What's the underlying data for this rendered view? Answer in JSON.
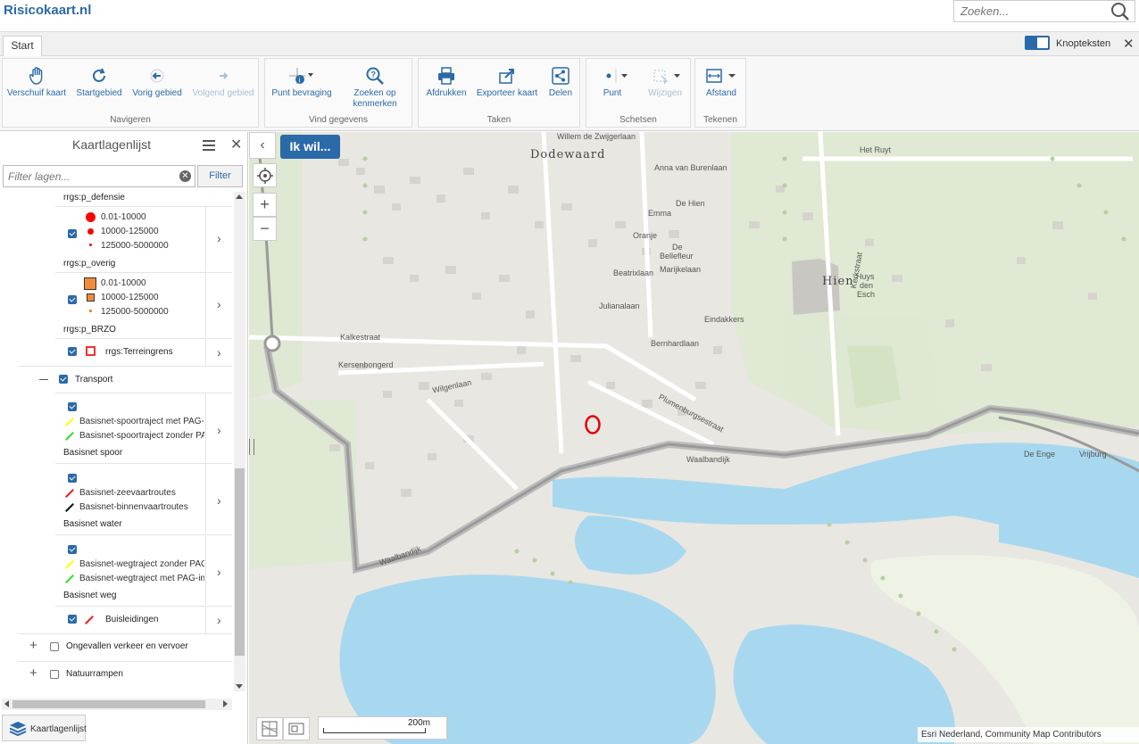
{
  "app": {
    "logo": "Risicokaart.nl"
  },
  "search": {
    "placeholder": "Zoeken..."
  },
  "tabs": {
    "start": "Start"
  },
  "toggle": {
    "label": "Knopteksten"
  },
  "ribbon": {
    "navigeren": {
      "label": "Navigeren",
      "verschuif": "Verschuif kaart",
      "startgebied": "Startgebied",
      "vorig": "Vorig gebied",
      "volgend": "Volgend gebied"
    },
    "vind": {
      "label": "Vind gegevens",
      "punt": "Punt bevraging",
      "zoeken1": "Zoeken op",
      "zoeken2": "kenmerken"
    },
    "taken": {
      "label": "Taken",
      "afdrukken": "Afdrukken",
      "exporteer": "Exporteer kaart",
      "delen": "Delen"
    },
    "schetsen": {
      "label": "Schetsen",
      "punt": "Punt",
      "wijzigen": "Wijzigen"
    },
    "tekenen": {
      "label": "Tekenen",
      "afstand": "Afstand"
    }
  },
  "panel": {
    "title": "Kaartlagenlijst",
    "filter_placeholder": "Filter lagen...",
    "filter_button": "Filter",
    "bottom_tab": "Kaartlagenlijst"
  },
  "layers": {
    "defensie": {
      "name": "rrgs:p_defensie",
      "legend": [
        "0.01-10000",
        "10000-125000",
        "125000-5000000"
      ]
    },
    "overig": {
      "name": "rrgs:p_overig",
      "legend": [
        "0.01-10000",
        "10000-125000",
        "125000-5000000"
      ]
    },
    "brzo": {
      "name": "rrgs:p_BRZO"
    },
    "terreingrens": {
      "name": "rrgs:Terreingrens"
    },
    "transport": {
      "name": "Transport"
    },
    "spoor": {
      "name": "Basisnet spoor",
      "legend": [
        "Basisnet-spoortraject met PAG-in",
        "Basisnet-spoortraject zonder PAG"
      ]
    },
    "water": {
      "name": "Basisnet water",
      "legend": [
        "Basisnet-zeevaartroutes",
        "Basisnet-binnenvaartroutes"
      ]
    },
    "weg": {
      "name": "Basisnet weg",
      "legend": [
        "Basisnet-wegtraject zonder PAG",
        "Basisnet-wegtraject met PAG-in"
      ]
    },
    "buisleidingen": {
      "name": "Buisleidingen"
    },
    "ongevallen": {
      "name": "Ongevallen verkeer en vervoer"
    },
    "natuurrampen": {
      "name": "Natuurrampen"
    }
  },
  "map": {
    "ikwil": "Ik wil...",
    "scale": "200m",
    "attribution": "Esri Nederland, Community Map Contributors",
    "labels": {
      "dodewaard": "Dodewaard",
      "hien": "Hien",
      "het_ruyt": "Het Ruyt",
      "anna": "Anna van Burenlaan",
      "de_hien": "De Hien",
      "emma": "Emma",
      "oranje": "Oranje",
      "bellefleur1": "De",
      "bellefleur2": "Bellefleur",
      "marijke": "Marijkelaan",
      "beatrix": "Beatrixlaan",
      "juliana": "Julianalaan",
      "eindakkers": "Eindakkers",
      "bernhard": "Bernhardlaan",
      "kalkestraat": "Kalkestraat",
      "kersenbongerd": "Kersenbongerd",
      "wilgenlaan": "Wilgenlaan",
      "waalbandijk1": "Waalbandijk",
      "waalbandijk2": "Waalbandijk",
      "de_enge": "De Enge",
      "vrijburg": "Vrijburg",
      "huys1": "Huys",
      "huys2": "den",
      "huys3": "Esch",
      "plumenburg": "Plumenburgsestraat",
      "willem": "Willem de Zwijgerlaan",
      "kerkstraat": "Kerkstraat"
    }
  },
  "colors": {
    "accent": "#2b6aa8",
    "red": "#ff0000",
    "orange": "#f28c3a",
    "yellow_line": "#ffff00",
    "green_line": "#33dd33",
    "water": "#a8d8ef",
    "road": "#9a9a9a"
  }
}
